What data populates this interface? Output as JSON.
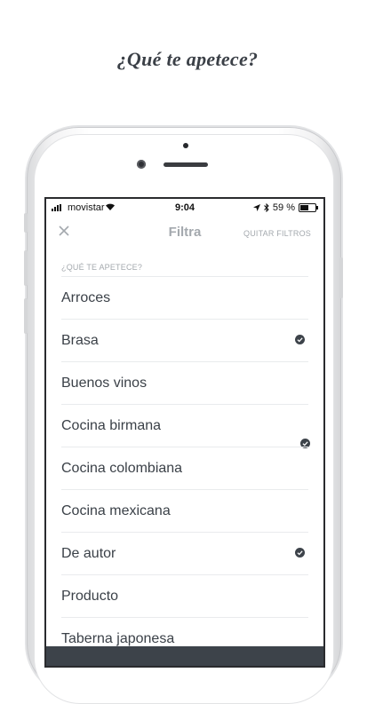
{
  "headline": "¿Qué te apetece?",
  "status_bar": {
    "carrier": "movistar",
    "time": "9:04",
    "battery": "59 %",
    "battery_level": 0.59
  },
  "nav": {
    "title": "Filtra",
    "clear_filters": "QUITAR FILTROS",
    "close_icon": "close-icon"
  },
  "section_label": "¿QUÉ TE APETECE?",
  "items": [
    {
      "label": "Arroces",
      "checked": false
    },
    {
      "label": "Brasa",
      "checked": true
    },
    {
      "label": "Buenos vinos",
      "checked": false
    },
    {
      "label": "Cocina birmana",
      "checked": true
    },
    {
      "label": "Cocina colombiana",
      "checked": false
    },
    {
      "label": "Cocina mexicana",
      "checked": false
    },
    {
      "label": "De autor",
      "checked": true
    },
    {
      "label": "Producto",
      "checked": false
    },
    {
      "label": "Taberna japonesa",
      "checked": false
    }
  ],
  "colors": {
    "text_dark": "#3b4148",
    "text_muted": "#a4a9ae",
    "check": "#3d434a",
    "apply_bar": "#3d434a"
  }
}
